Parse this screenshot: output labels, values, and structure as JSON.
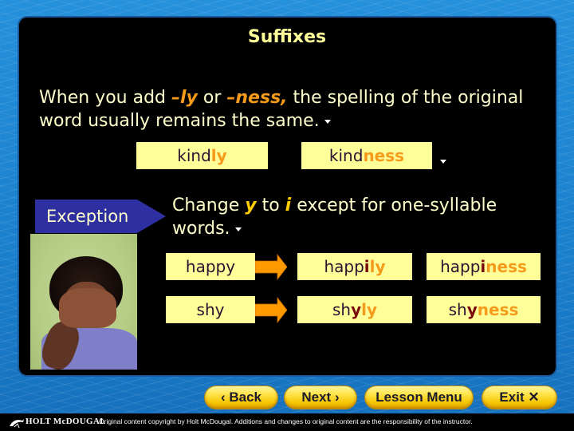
{
  "slide": {
    "title": "Suffixes",
    "intro": {
      "part1": "When you add ",
      "suffix1": "–ly",
      "part2": " or ",
      "suffix2": "–ness,",
      "part3": " the spelling of the original word usually remains the same."
    },
    "examples": [
      {
        "base": "kind",
        "suffix": "ly"
      },
      {
        "base": "kind",
        "suffix": "ness"
      }
    ],
    "exception_label": "Exception",
    "rule": {
      "part1": "Change ",
      "y": "y",
      "part2": " to ",
      "i": "i",
      "part3": " except for one-syllable words."
    },
    "transform_rows": [
      {
        "base": "happy",
        "ly": {
          "stem": "happ",
          "changed": "i",
          "suffix": "ly"
        },
        "ness": {
          "stem": "happ",
          "changed": "i",
          "suffix": "ness"
        }
      },
      {
        "base": "shy",
        "ly": {
          "stem": "sh",
          "changed": "y",
          "suffix": "ly"
        },
        "ness": {
          "stem": "sh",
          "changed": "y",
          "suffix": "ness"
        }
      }
    ],
    "photo_alt": "child covering face with hands"
  },
  "nav": {
    "back": "‹ Back",
    "next": "Next ›",
    "lesson_menu": "Lesson Menu",
    "exit": "Exit ✕"
  },
  "footer": {
    "brand": "HOLT McDOUGAL",
    "copyright": "Original content copyright by Holt McDougal. Additions and changes to original content are the responsibility of the instructor."
  },
  "colors": {
    "title": "#ffff99",
    "suffix_highlight": "#f59a1a",
    "changed_letter": "#7a0a0a",
    "box_bg": "#ffff99",
    "exception_bg": "#2e2fa0",
    "arrow": "#ff9900",
    "background": "#1c86d4"
  }
}
